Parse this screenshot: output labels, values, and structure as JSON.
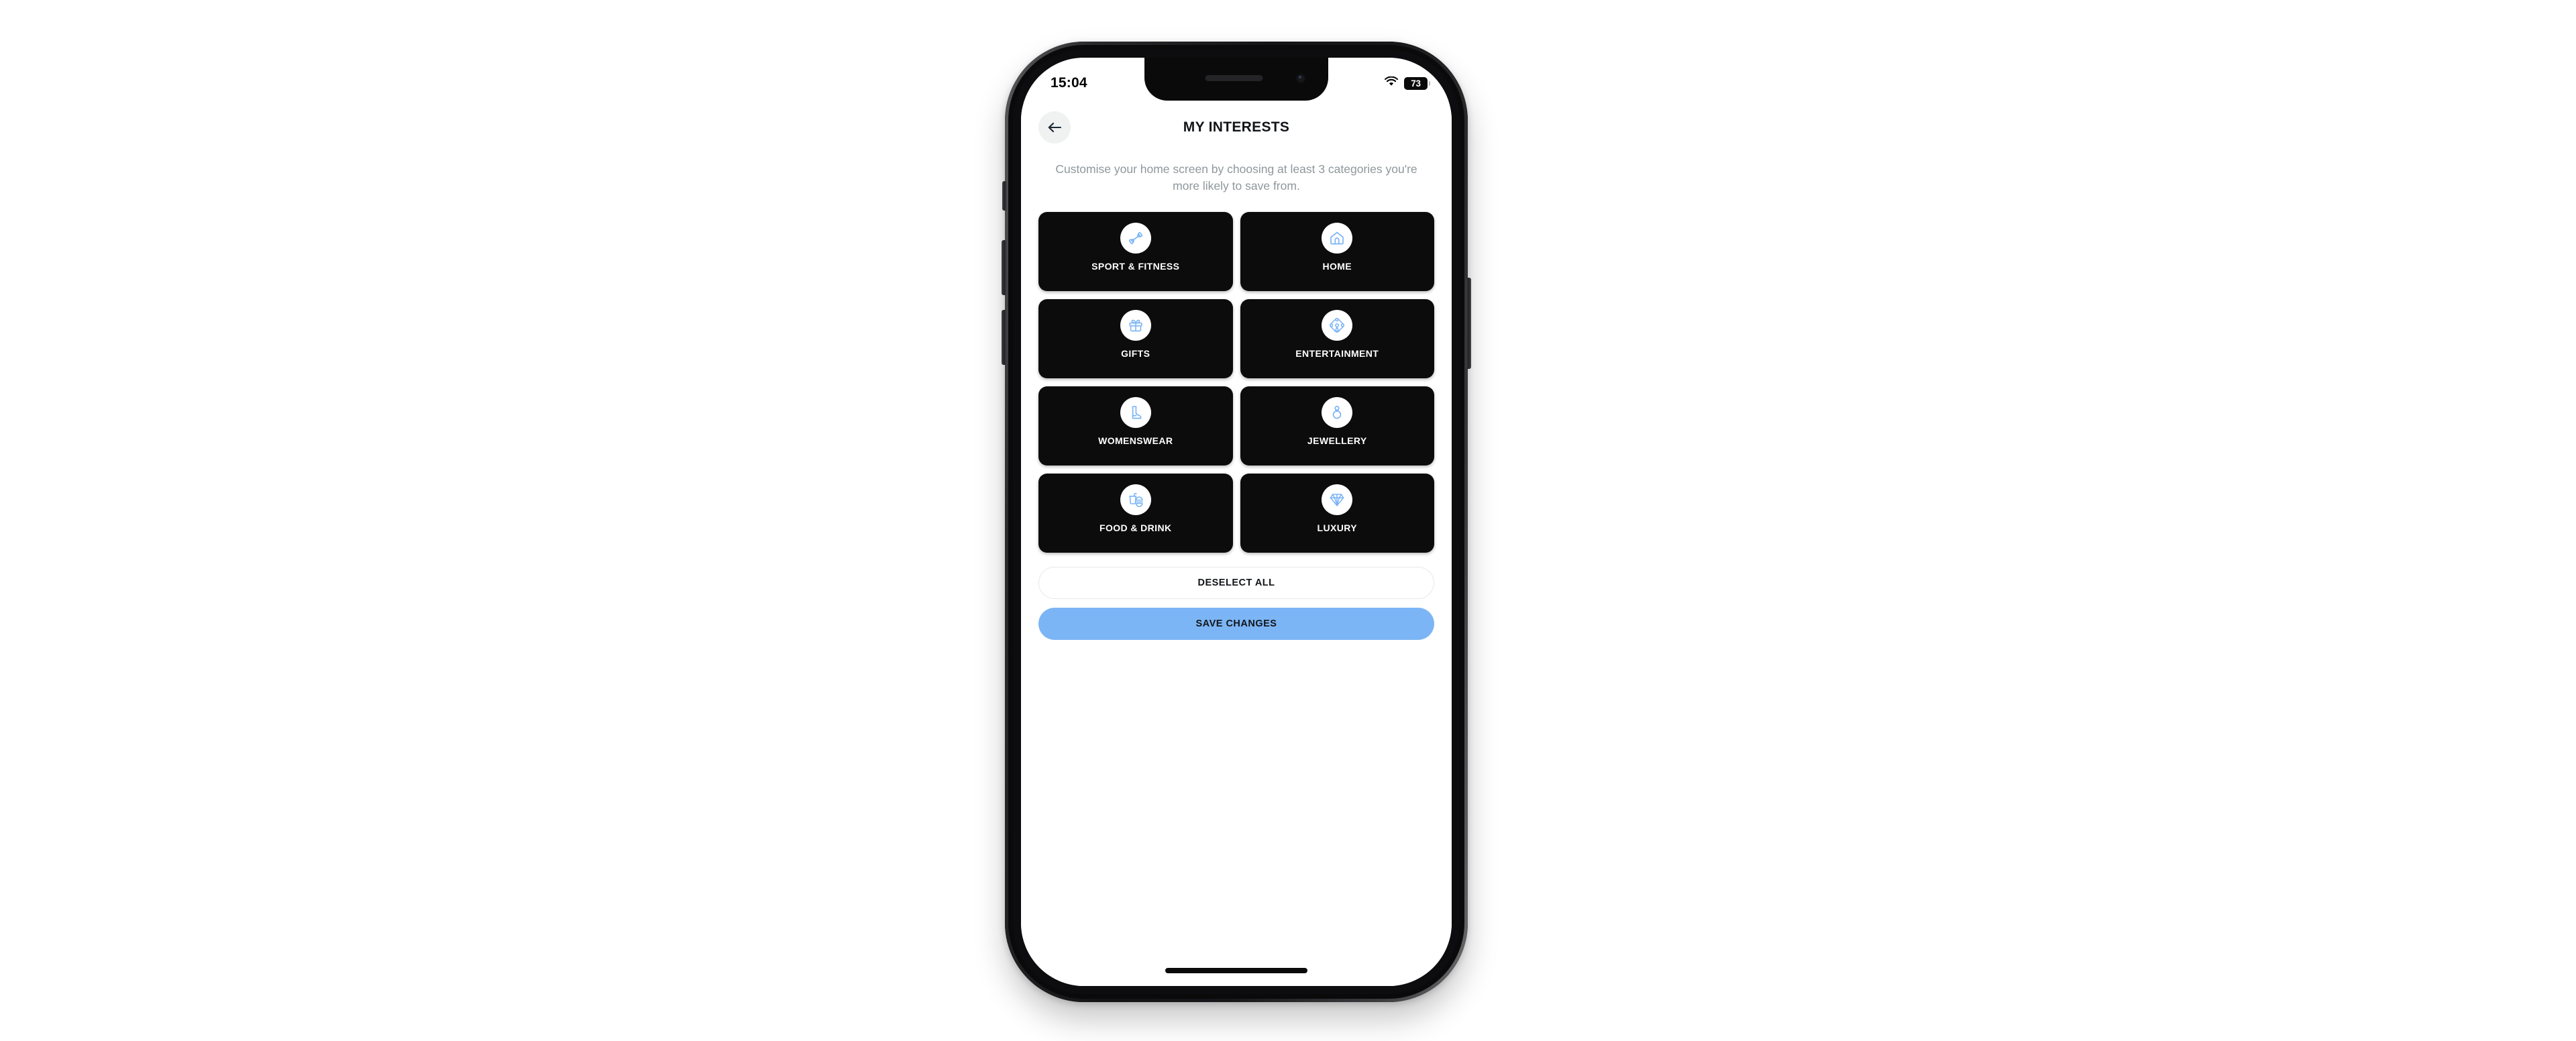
{
  "device": {
    "name": "iphone-mockup",
    "frame_color": "#1b1b1d",
    "screen_background": "#ffffff"
  },
  "status_bar": {
    "time": "15:04",
    "wifi_icon": "wifi-icon",
    "battery_level": "73",
    "battery_icon": "battery-icon"
  },
  "navbar": {
    "back_icon": "arrow-left-icon",
    "title": "MY INTERESTS"
  },
  "description": "Customise your home screen by choosing at least 3 categories you're more likely to save from.",
  "categories": [
    {
      "label": "SPORT & FITNESS",
      "icon": "dumbbell-icon",
      "selected": true
    },
    {
      "label": "HOME",
      "icon": "house-icon",
      "selected": true
    },
    {
      "label": "GIFTS",
      "icon": "gift-icon",
      "selected": true
    },
    {
      "label": "ENTERTAINMENT",
      "icon": "ferris-wheel-icon",
      "selected": true
    },
    {
      "label": "WOMENSWEAR",
      "icon": "boot-icon",
      "selected": true
    },
    {
      "label": "JEWELLERY",
      "icon": "ring-icon",
      "selected": true
    },
    {
      "label": "FOOD & DRINK",
      "icon": "food-drink-icon",
      "selected": true
    },
    {
      "label": "LUXURY",
      "icon": "diamond-icon",
      "selected": true
    }
  ],
  "actions": {
    "deselect_all_label": "DESELECT ALL",
    "save_changes_label": "SAVE CHANGES"
  },
  "colors": {
    "card_background": "#0c0c0c",
    "card_text": "#ffffff",
    "icon_accent": "#7cb5f5",
    "primary_button": "#7cb5f5",
    "description_text": "#8e979b",
    "title_text": "#111418"
  }
}
